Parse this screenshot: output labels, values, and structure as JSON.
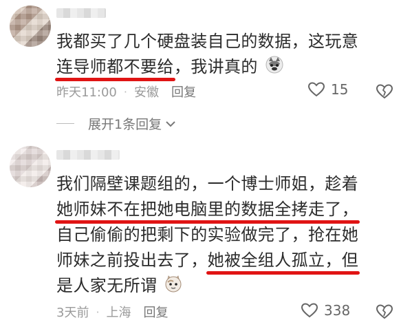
{
  "comments": [
    {
      "lines": [
        [
          "我都买了几个硬盘装自己的数据，这玩意"
        ],
        [
          "连导师都不要给",
          "，我讲真的"
        ]
      ],
      "emoji": "husky-emoji",
      "time": "昨天11:00",
      "location": "安徽",
      "reply_label": "回复",
      "likes": "15"
    },
    {
      "lines": [
        [
          "我们隔壁课题组的，一个博士师姐，趁着"
        ],
        [
          "她师妹不在把她电脑里的数据全拷走了，"
        ],
        [
          "自己偷偷的把剩下的实验做完了，抢在她"
        ],
        [
          "师妹之前投出去了，",
          "她被全组人孤立，但"
        ],
        [
          "是人家无所谓"
        ]
      ],
      "emoji": "cat-emoji",
      "time": "3天前",
      "location": "上海",
      "reply_label": "回复",
      "likes": "338"
    }
  ],
  "expand_label": "展开1条回复",
  "colors": {
    "highlight": "#e01414",
    "meta": "#9a9a9a"
  }
}
